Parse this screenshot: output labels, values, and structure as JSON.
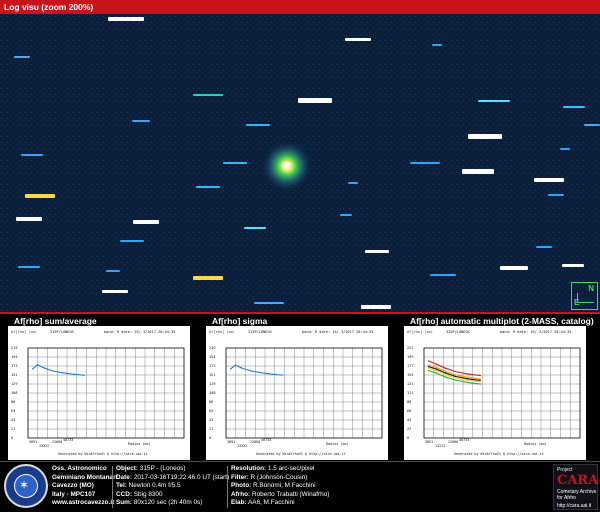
{
  "header": {
    "title": "Log visu (zoom 200%)"
  },
  "compass": {
    "north": "N",
    "east": "E"
  },
  "panels": [
    {
      "title": "Af[rho] sum/average",
      "chart_data": {
        "type": "line",
        "header_id": "315P/LONEOS",
        "header_info": "band: R  date: 16/ 3/2017 20:44:35",
        "ylabel": "Af[rho] (cm)",
        "xlabel": "Radius (km)",
        "yticks": [
          "215",
          "194",
          "173",
          "151",
          "129",
          "108",
          "86",
          "65",
          "43",
          "21",
          "0"
        ],
        "xticks": [
          "3891",
          "13222",
          "22660",
          "40733"
        ],
        "xlim": [
          0,
          100
        ],
        "ylim": [
          0,
          215
        ],
        "series": [
          {
            "color": "#1f7fd8",
            "x": [
              3,
              6,
              10,
              16,
              22,
              30,
              36
            ],
            "y": [
              165,
              175,
              168,
              160,
              156,
              152,
              150
            ]
          }
        ],
        "footer": "Generated by WinAfrhoV1 @ http://cara.uai.it"
      }
    },
    {
      "title": "Af[rho] sigma",
      "chart_data": {
        "type": "line",
        "header_id": "315P/LONEOS",
        "header_info": "band: R  date: 16/ 3/2017 20:44:35",
        "ylabel": "Af[rho] (cm)",
        "xlabel": "Radius (km)",
        "yticks": [
          "216",
          "194",
          "173",
          "151",
          "129",
          "108",
          "86",
          "65",
          "43",
          "21",
          "0"
        ],
        "xticks": [
          "3891",
          "13222",
          "22660",
          "40733"
        ],
        "xlim": [
          0,
          100
        ],
        "ylim": [
          0,
          216
        ],
        "series": [
          {
            "color": "#1f7fd8",
            "x": [
              3,
              6,
              10,
              16,
              22,
              30,
              36
            ],
            "y": [
              166,
              175,
              168,
              161,
              157,
              153,
              151
            ]
          }
        ],
        "footer": "Generated by WinAfrhoV1 @ http://cara.uai.it"
      }
    },
    {
      "title": "Af[rho] automatic multiplot (2-MASS, catalog)",
      "chart_data": {
        "type": "line",
        "header_id": "315P/LONEOS",
        "header_info": "band: R  date: 16/ 3/2017 20:44:35",
        "ylabel": "Af[rho] (cm)",
        "xlabel": "Radius (km)",
        "yticks": [
          "222",
          "199",
          "177",
          "155",
          "133",
          "111",
          "88",
          "66",
          "44",
          "22",
          "0"
        ],
        "xticks": [
          "3891",
          "13222",
          "22660",
          "40733"
        ],
        "xlim": [
          0,
          100
        ],
        "ylim": [
          0,
          222
        ],
        "series": [
          {
            "color": "#d81f1f",
            "x": [
              3,
              8,
              14,
              20,
              28,
              36
            ],
            "y": [
              190,
              182,
              172,
              164,
              158,
              154
            ]
          },
          {
            "color": "#f0a020",
            "x": [
              3,
              8,
              14,
              20,
              28,
              36
            ],
            "y": [
              180,
              174,
              164,
              156,
              150,
              146
            ]
          },
          {
            "color": "#ffd020",
            "x": [
              3,
              8,
              14,
              20,
              28,
              36
            ],
            "y": [
              172,
              166,
              156,
              148,
              142,
              138
            ]
          },
          {
            "color": "#20b040",
            "x": [
              3,
              8,
              14,
              20,
              28,
              36
            ],
            "y": [
              166,
              160,
              150,
              143,
              137,
              133
            ]
          },
          {
            "color": "#111111",
            "x": [
              3,
              8,
              14,
              20,
              28,
              36
            ],
            "y": [
              176,
              170,
              160,
              152,
              146,
              142
            ]
          }
        ],
        "footer": "Generated by WinAfrhoV1 @ http://cara.uai.it"
      }
    }
  ],
  "footer": {
    "observatory": {
      "name_line1": "Oss. Astronomico",
      "name_line2": "Geminiano Montanari",
      "location": "Cavezzo (MO)",
      "country": "Italy - MPC107",
      "website": "www.astrocavezzo.it"
    },
    "info_mid": [
      {
        "label": "Object:",
        "value": " 315P - (Loneos)"
      },
      {
        "label": "Date:",
        "value": " 2017-03-16T19:22:46.0 UT (start)"
      },
      {
        "label": "Tel:",
        "value": " Newton 0.4m f/5.5"
      },
      {
        "label": "CCD:",
        "value": " Sbig 8300"
      },
      {
        "label": "Sum:",
        "value": " 80x120 sec (2h 40m 0s)"
      }
    ],
    "info_right": [
      {
        "label": "Resolution:",
        "value": " 1.5 arc-sec/pixel"
      },
      {
        "label": "Filter:",
        "value": " R (Johnson-Cousin)"
      },
      {
        "label": "Photo:",
        "value": " R.Bonomi, M.Facchini"
      },
      {
        "label": "Afrho:",
        "value": " Roberto Trabatti (Winafrho)"
      },
      {
        "label": "Elab:",
        "value": " AA6, M.Facchini"
      }
    ],
    "cara": {
      "project": "Project",
      "name": "CARA",
      "sub1": "Cometary Archive",
      "sub2": "for Afrho",
      "url": "http://cara.uai.it"
    }
  }
}
